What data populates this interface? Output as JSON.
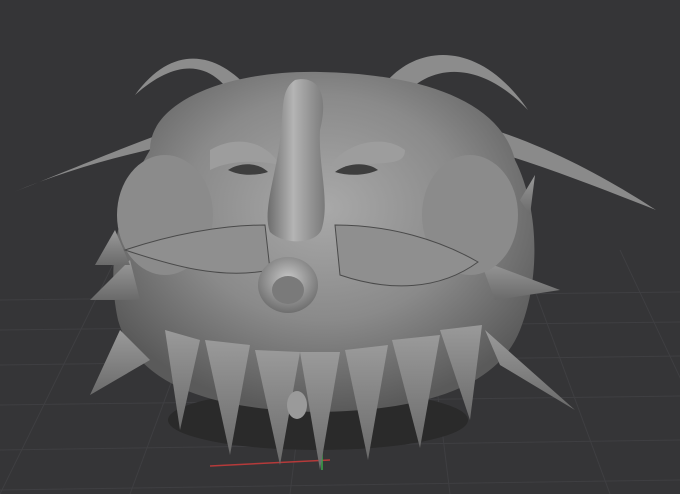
{
  "app": {
    "view": "3d-viewport"
  },
  "viewport": {
    "background_color": "#353537",
    "grid_color": "#3f3f42",
    "axis_x_color": "#b53a3a",
    "axis_z_color": "#3aa84a",
    "model": {
      "name_icon": "sculpted-creature-head",
      "material_color": "#8e8e8e",
      "shadow_color": "#3a3a3a"
    }
  }
}
